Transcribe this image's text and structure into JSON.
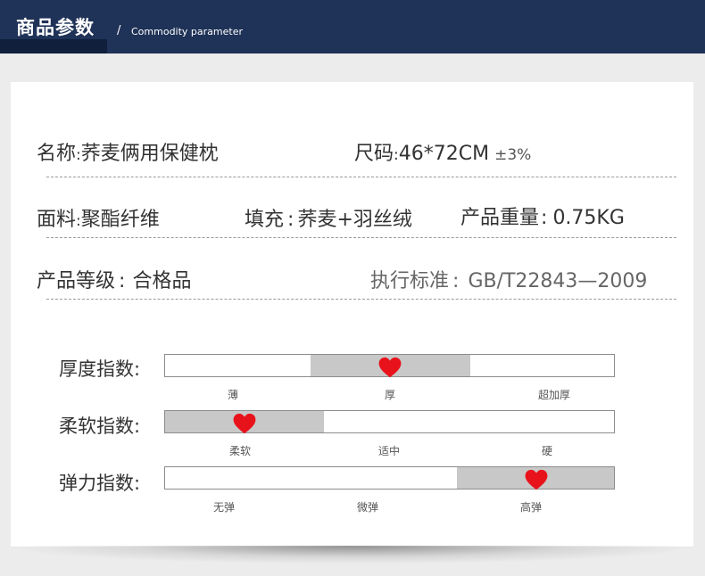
{
  "header": {
    "title": "商品参数",
    "slash": "/",
    "subtitle": "Commodity parameter",
    "bg_color": "#1f3257"
  },
  "params": [
    {
      "label": "名称",
      "sep": ":",
      "value": "荞麦俩用保健枕"
    },
    {
      "label": "尺码",
      "sep": ":",
      "value": "46*72CM",
      "extra": "±3%"
    },
    {
      "label": "面料",
      "sep": ":",
      "value": "聚酯纤维"
    },
    {
      "label": "填充",
      "sep": ":",
      "value": "荞麦+羽丝绒"
    },
    {
      "label": "产品重量",
      "sep": ":",
      "value": "0.75KG"
    },
    {
      "label": "产品等级",
      "sep": ":",
      "value": "合格品"
    },
    {
      "label": "执行标准",
      "sep": ":",
      "value": "GB/T22843—2009"
    }
  ],
  "indices": [
    {
      "label": "厚度指数:",
      "ticks": [
        "薄",
        "厚",
        "超加厚"
      ],
      "highlight_index": 1
    },
    {
      "label": "柔软指数:",
      "ticks": [
        "柔软",
        "适中",
        "硬"
      ],
      "highlight_index": 0
    },
    {
      "label": "弹力指数:",
      "ticks": [
        "无弹",
        "微弹",
        "高弹"
      ],
      "highlight_index": 2
    }
  ],
  "colors": {
    "heart": "#e8121b",
    "highlight_fill": "#c8c8c8"
  }
}
